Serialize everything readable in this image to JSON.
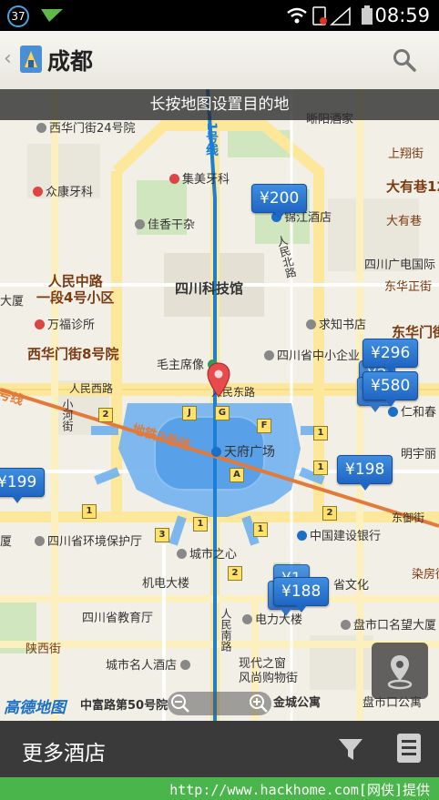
{
  "status_bar": {
    "notification_count": "37",
    "time": "08:59"
  },
  "header": {
    "city": "成都"
  },
  "map": {
    "hint": "长按地图设置目的地",
    "metro_line_1": "1号线",
    "metro_line_2": "地铁2号线",
    "streets": {
      "renmin_xilu": "人民西路",
      "renmin_donglu": "人民东路",
      "renmin_beilu": "人民北路",
      "renmin_nanlu": "人民南路",
      "xiaohejie": "小河街",
      "dongyudao": "东御街",
      "hao2": "号线"
    },
    "places": {
      "xihuamen24": "西华门街24号院",
      "jimei": "集美牙科",
      "zhongkang": "众康牙科",
      "jiaxiang": "佳香干杂",
      "jinjiang": "锦江酒店",
      "xiyang": "晰阳酒家",
      "dayouxiang": "大有巷12",
      "shanghanmiao": "上翔街",
      "dayou": "大有巷",
      "guangdian": "四川广电国际",
      "dongdazheng": "东华正街",
      "renminzhonglu": "人民中路\n一段4号小区",
      "sichuankeji": "四川科技馆",
      "wanfu": "万福诊所",
      "qiuzhi": "求知书店",
      "donghuamen": "东华门街",
      "xihuamen8": "西华门街8号院",
      "maozhuxi": "毛主席像",
      "zhongxiaoqiye": "四川省中小企业",
      "renhechun": "仁和春",
      "tianfu": "天府广场",
      "mingyu": "明宇丽",
      "huanjing": "四川省环境保护厅",
      "jianshe": "中国建设银行",
      "chengshi": "城市之心",
      "jidian": "机电大楼",
      "jiaoyuting": "四川省教育厅",
      "dianli": "电力大楼",
      "shengwenhua": "省文化",
      "panshikou": "盘市口名望大厦",
      "chengshimingren": "城市名人酒店",
      "xiandai": "现代之窗\n风尚购物街",
      "shanxijie": "陕西街",
      "jinwuli": "金城公寓",
      "pengshi": "盘市口公寓",
      "ranfang": "染房街",
      "zhongfulu": "中富路第50号院",
      "nandaxia": "大厦",
      "nan": "南",
      "nai": "大厦",
      "xiang": "厦"
    },
    "price_tags": [
      "¥200",
      "¥296",
      "¥580",
      "¥198",
      "¥199",
      "¥188"
    ],
    "metro_exits": [
      "1",
      "2",
      "J",
      "G",
      "F",
      "1",
      "A",
      "2",
      "1",
      "1",
      "3",
      "2",
      "1"
    ],
    "logo": "高德地图"
  },
  "bottom_bar": {
    "more_hotels": "更多酒店"
  },
  "footer": {
    "watermark": "http://www.hackhome.com[网侠]提供"
  }
}
